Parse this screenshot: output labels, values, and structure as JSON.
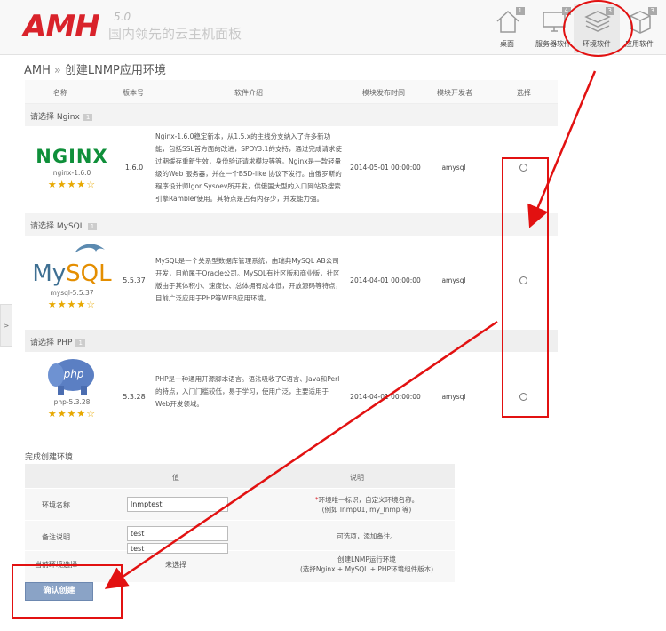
{
  "header": {
    "logo": "AMH",
    "version": "5.0",
    "slogan": "国内领先的云主机面板",
    "nav": [
      {
        "label": "桌面",
        "badge": "1",
        "icon": "house-icon"
      },
      {
        "label": "服务器软件",
        "badge": "4",
        "icon": "monitor-icon"
      },
      {
        "label": "环境软件",
        "badge": "3",
        "icon": "layers-icon"
      },
      {
        "label": "应用软件",
        "badge": "3",
        "icon": "box-icon"
      }
    ]
  },
  "breadcrumb": {
    "root": "AMH",
    "separator": "»",
    "current": "创建LNMP应用环境"
  },
  "table": {
    "headers": [
      "名称",
      "版本号",
      "软件介绍",
      "模块发布时间",
      "模块开发者",
      "选择"
    ],
    "sections": [
      {
        "title": "请选择 Nginx",
        "badge": "1",
        "logo": "NGINX",
        "name": "nginx-1.6.0",
        "stars": "★★★★☆",
        "version": "1.6.0",
        "description": "Nginx-1.6.0稳定新本，从1.5.x的主线分支纳入了许多新功能，包括SSL首方面的改进，SPDY3.1的支持，通过完成请求使过期缓存重新生效，身份验证请求模块等等。Nginx是一款轻量级的Web 服务器，并在一个BSD-like 协议下发行。由俄罗斯的程序设计师Igor Sysoev所开发，供俄国大型的入口网站及搜索引擎Rambler使用。其特点是占有内存少，并发能力强。",
        "date": "2014-05-01 00:00:00",
        "developer": "amysql"
      },
      {
        "title": "请选择 MySQL",
        "badge": "1",
        "logo_a": "My",
        "logo_b": "SQL",
        "name": "mysql-5.5.37",
        "stars": "★★★★☆",
        "version": "5.5.37",
        "description": "MySQL是一个关系型数据库管理系统，由瑞典MySQL AB公司开发，目前属于Oracle公司。MySQL有社区版和商业版，社区版由于其体积小、速度快、总体拥有成本低，开放源码等特点，目前广泛应用于PHP等WEB应用环境。",
        "date": "2014-04-01 00:00:00",
        "developer": "amysql"
      },
      {
        "title": "请选择 PHP",
        "badge": "1",
        "logo": "php",
        "name": "php-5.3.28",
        "stars": "★★★★☆",
        "version": "5.3.28",
        "description": "PHP是一种通用开源脚本语言。语法吸收了C语言、Java和Perl的特点，入门门槛较低，易于学习，使用广泛，主要适用于Web开发领域。",
        "date": "2014-04-01 00:00:00",
        "developer": "amysql"
      }
    ]
  },
  "create": {
    "title": "完成创建环境",
    "col_value": "值",
    "col_note": "说明",
    "rows": [
      {
        "label": "环境名称",
        "value": "lnmptest",
        "note_req": "*",
        "note": "环境唯一标识，自定义环境名称。",
        "note2": "(例如 lnmp01, my_lnmp 等)"
      },
      {
        "label": "备注说明",
        "value": "test",
        "note": "可选项，添加备注。",
        "suggest": "test"
      },
      {
        "label": "当前环境选择",
        "value": "未选择",
        "note": "创建LNMP运行环境",
        "note2": "(选择Nginx + MySQL + PHP环境组件版本)"
      }
    ],
    "button": "确认创建"
  },
  "side_toggle": ">",
  "colors": {
    "brand": "#d9232b",
    "annotation": "#e21111",
    "button": "#8aa3c6"
  }
}
